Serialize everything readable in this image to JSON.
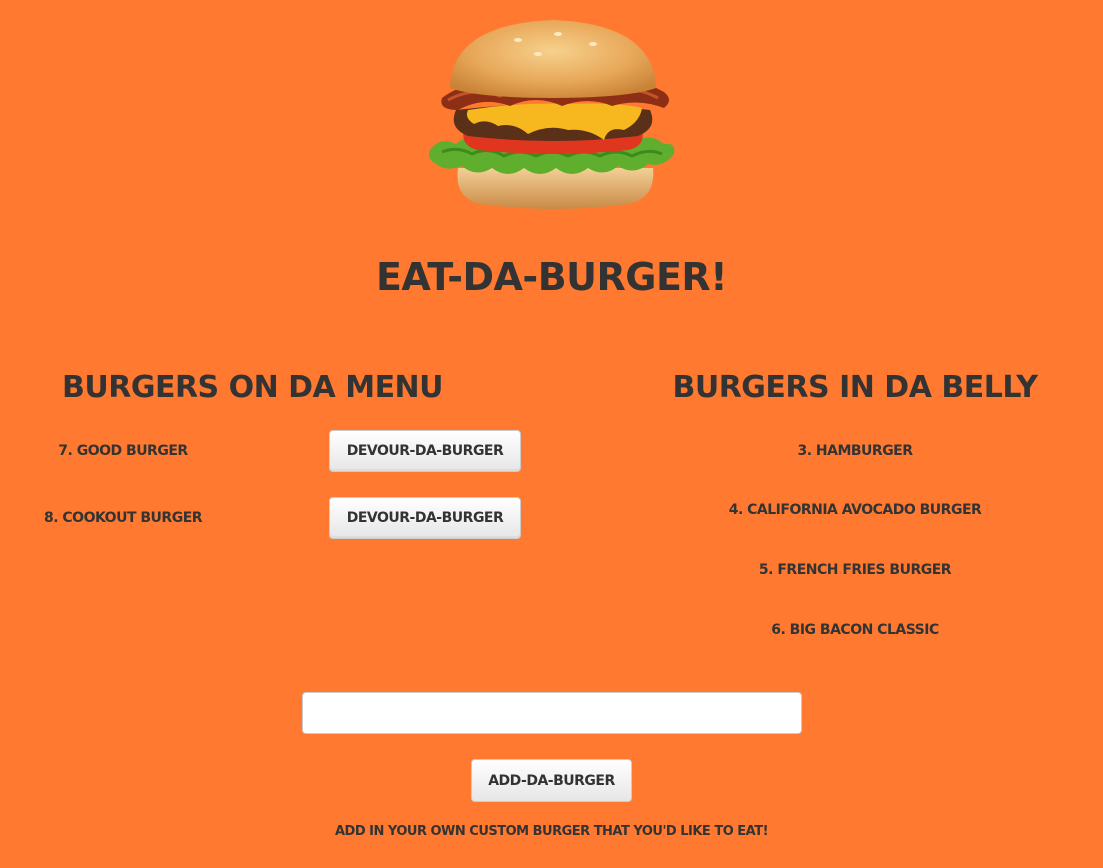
{
  "header": {
    "title": "Eat-Da-Burger!"
  },
  "menu": {
    "heading": "Burgers on da menu",
    "devour_label": "Devour-Da-Burger",
    "items": [
      {
        "label": "7. Good Burger"
      },
      {
        "label": "8. Cookout Burger"
      }
    ]
  },
  "eaten": {
    "heading": "Burgers in da belly",
    "items": [
      {
        "label": "3. Hamburger"
      },
      {
        "label": "4. California Avocado Burger"
      },
      {
        "label": "5. French Fries Burger"
      },
      {
        "label": "6. Big Bacon Classic"
      }
    ]
  },
  "form": {
    "input_value": "",
    "input_placeholder": "",
    "add_label": "Add-Da-Burger",
    "helper_text": "Add in your own custom burger that you'd like to eat!"
  },
  "colors": {
    "background": "#ff7a30",
    "text": "#333333",
    "button_bg": "#f5f5f5",
    "button_border": "#cccccc"
  },
  "icons": {
    "hero": "burger-image"
  }
}
